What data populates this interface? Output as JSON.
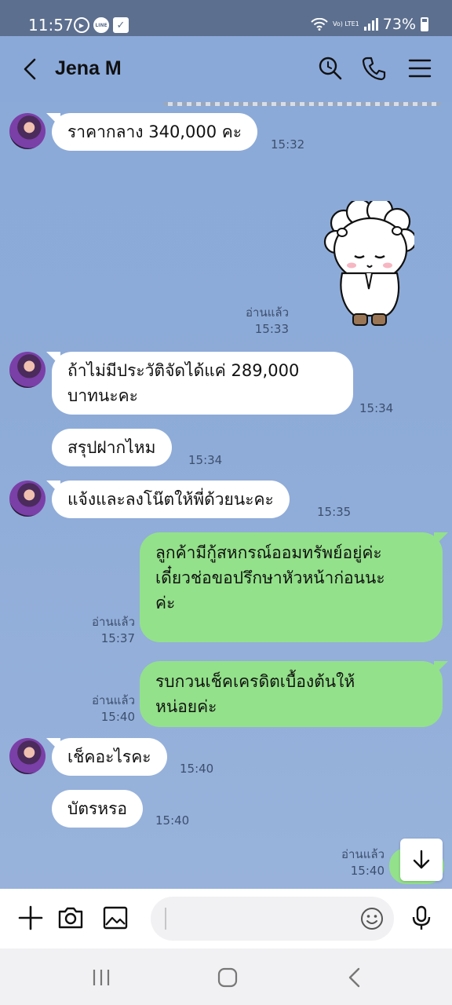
{
  "status_bar": {
    "time": "11:57",
    "lte_label": "Vo) LTE1",
    "battery": "73%"
  },
  "header": {
    "contact_name": "Jena M"
  },
  "messages": [
    {
      "text": "ราคากลาง 340,000 คะ",
      "time": "15:32"
    },
    {
      "read": "อ่านแล้ว",
      "time": "15:33"
    },
    {
      "line1": "ถ้าไม่มีประวัติจัดได้แค่ 289,000",
      "line2": "บาทนะคะ",
      "time": "15:34"
    },
    {
      "text": "สรุปฝากไหม",
      "time": "15:34"
    },
    {
      "text": "แจ้งและลงโน๊ตให้พี่ด้วยนะคะ",
      "time": "15:35"
    },
    {
      "line1": "ลูกค้ามีกู้สหกรณ์ออมทรัพย์อยู่ค่ะ",
      "line2": "เดี๋ยวช่อขอปรึกษาหัวหน้าก่อนนะ",
      "line3": "ค่ะ",
      "read": "อ่านแล้ว",
      "time": "15:37"
    },
    {
      "line1": " รบกวนเช็คเครดิตเบื้องต้นให้",
      "line2": "หน่อยค่ะ",
      "read": "อ่านแล้ว",
      "time": "15:40"
    },
    {
      "text": "เช็คอะไรคะ",
      "time": "15:40"
    },
    {
      "text": "บัตรหรอ",
      "time": "15:40"
    },
    {
      "read": "อ่านแล้ว",
      "time": "15:40"
    }
  ],
  "colors": {
    "chat_background": "#8eabd8",
    "incoming_bubble": "#ffffff",
    "outgoing_bubble": "#93e18a",
    "status_bar": "#5c6f8f"
  },
  "icons": {
    "header": [
      "back-icon",
      "search-icon",
      "phone-icon",
      "menu-icon"
    ],
    "input": [
      "plus-icon",
      "camera-icon",
      "image-icon",
      "emoji-icon",
      "microphone-icon"
    ],
    "nav": [
      "recent-apps-icon",
      "home-icon",
      "back-nav-icon"
    ]
  }
}
